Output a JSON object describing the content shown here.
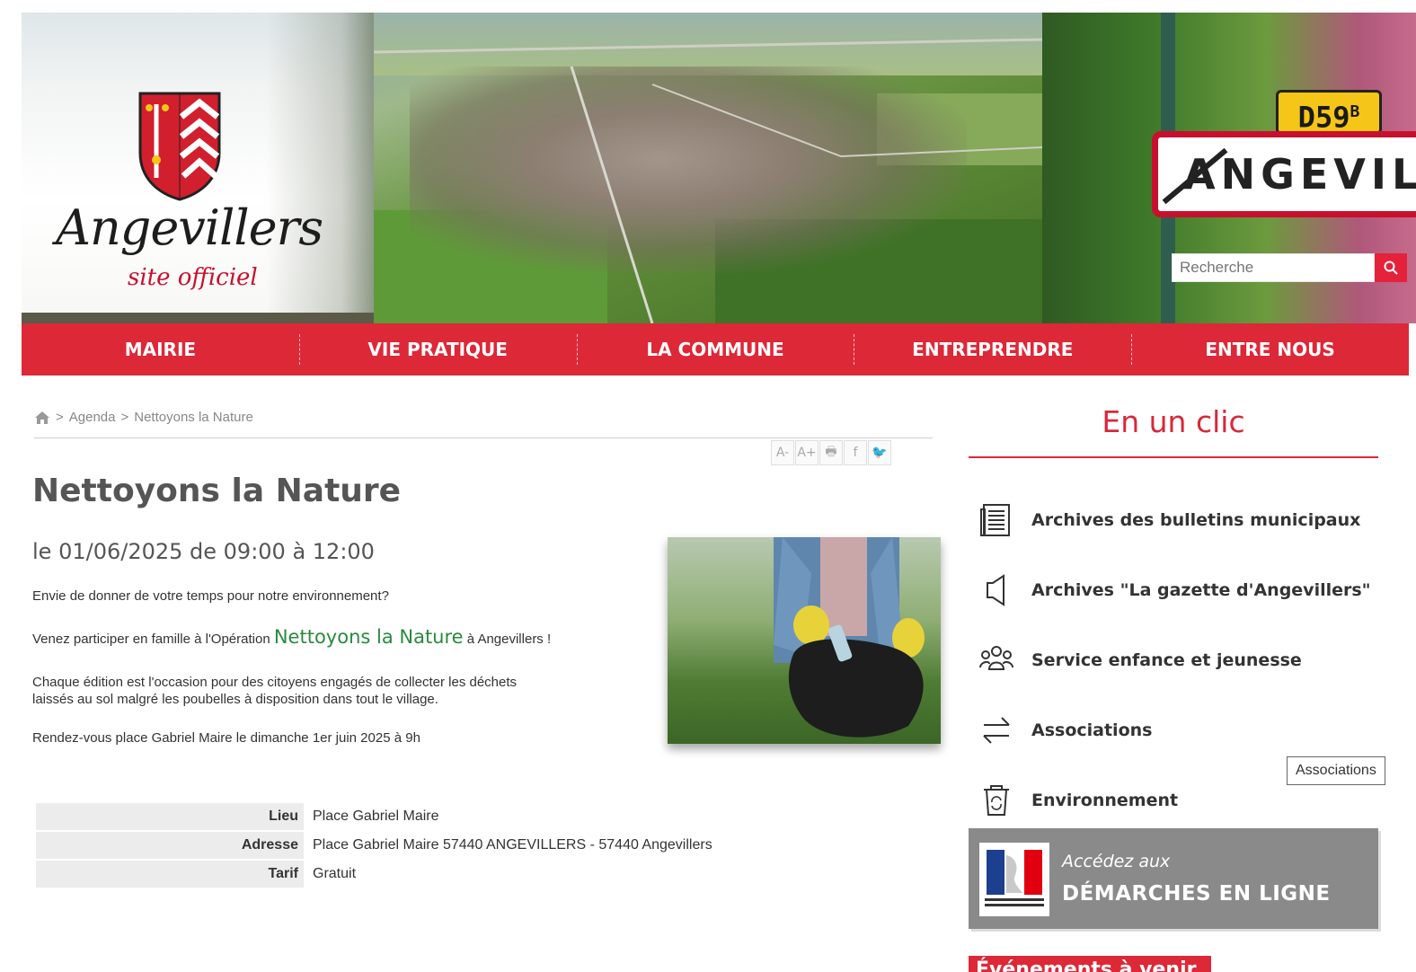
{
  "header": {
    "logo_title": "Angevillers",
    "logo_subtitle": "site officiel",
    "road_tag": "D59",
    "road_tag_sup": "B",
    "town_sign": "ANGEVILLE",
    "search": {
      "placeholder": "Recherche"
    }
  },
  "nav": {
    "items": [
      "MAIRIE",
      "VIE PRATIQUE",
      "LA COMMUNE",
      "ENTREPRENDRE",
      "ENTRE NOUS"
    ]
  },
  "breadcrumb": {
    "separator": ">",
    "items": [
      "Agenda",
      "Nettoyons la Nature"
    ]
  },
  "tools": [
    "A-",
    "A+",
    "🖶",
    "f",
    "🐦"
  ],
  "event": {
    "title": "Nettoyons la Nature",
    "date": "le 01/06/2025 de 09:00 à 12:00",
    "intro": "Envie de donner de votre temps pour notre environnement?",
    "invite_prefix": "Venez participer en famille à l'Opération ",
    "invite_highlight": "Nettoyons la Nature",
    "invite_suffix": " à Angevillers !",
    "desc_line1": "Chaque édition est l'occasion pour des citoyens engagés de collecter les déchets",
    "desc_line2": "laissés au sol malgré les poubelles à disposition dans tout le village.",
    "rdv": "Rendez-vous place Gabriel Maire le dimanche 1er juin 2025 à 9h",
    "info": [
      {
        "label": "Lieu",
        "value": "Place Gabriel Maire"
      },
      {
        "label": "Adresse",
        "value": "Place Gabriel Maire 57440 ANGEVILLERS - 57440 Angevillers"
      },
      {
        "label": "Tarif",
        "value": "Gratuit"
      }
    ]
  },
  "sidebar": {
    "title": "En un clic",
    "items": [
      {
        "label": "Archives des bulletins municipaux",
        "icon": "newspaper-icon"
      },
      {
        "label": "Archives \"La gazette d'Angevillers\"",
        "icon": "megaphone-icon"
      },
      {
        "label": "Service enfance et jeunesse",
        "icon": "people-icon"
      },
      {
        "label": "Associations",
        "icon": "exchange-arrows-icon"
      },
      {
        "label": "Environnement",
        "icon": "recycle-bin-icon"
      }
    ],
    "tooltip": "Associations",
    "demarches_small": "Accédez aux",
    "demarches_big": "DÉMARCHES EN LIGNE",
    "next_banner": "Événements à venir"
  },
  "colors": {
    "brand_red": "#dd2838",
    "highlight_green": "#2a8a3e"
  }
}
